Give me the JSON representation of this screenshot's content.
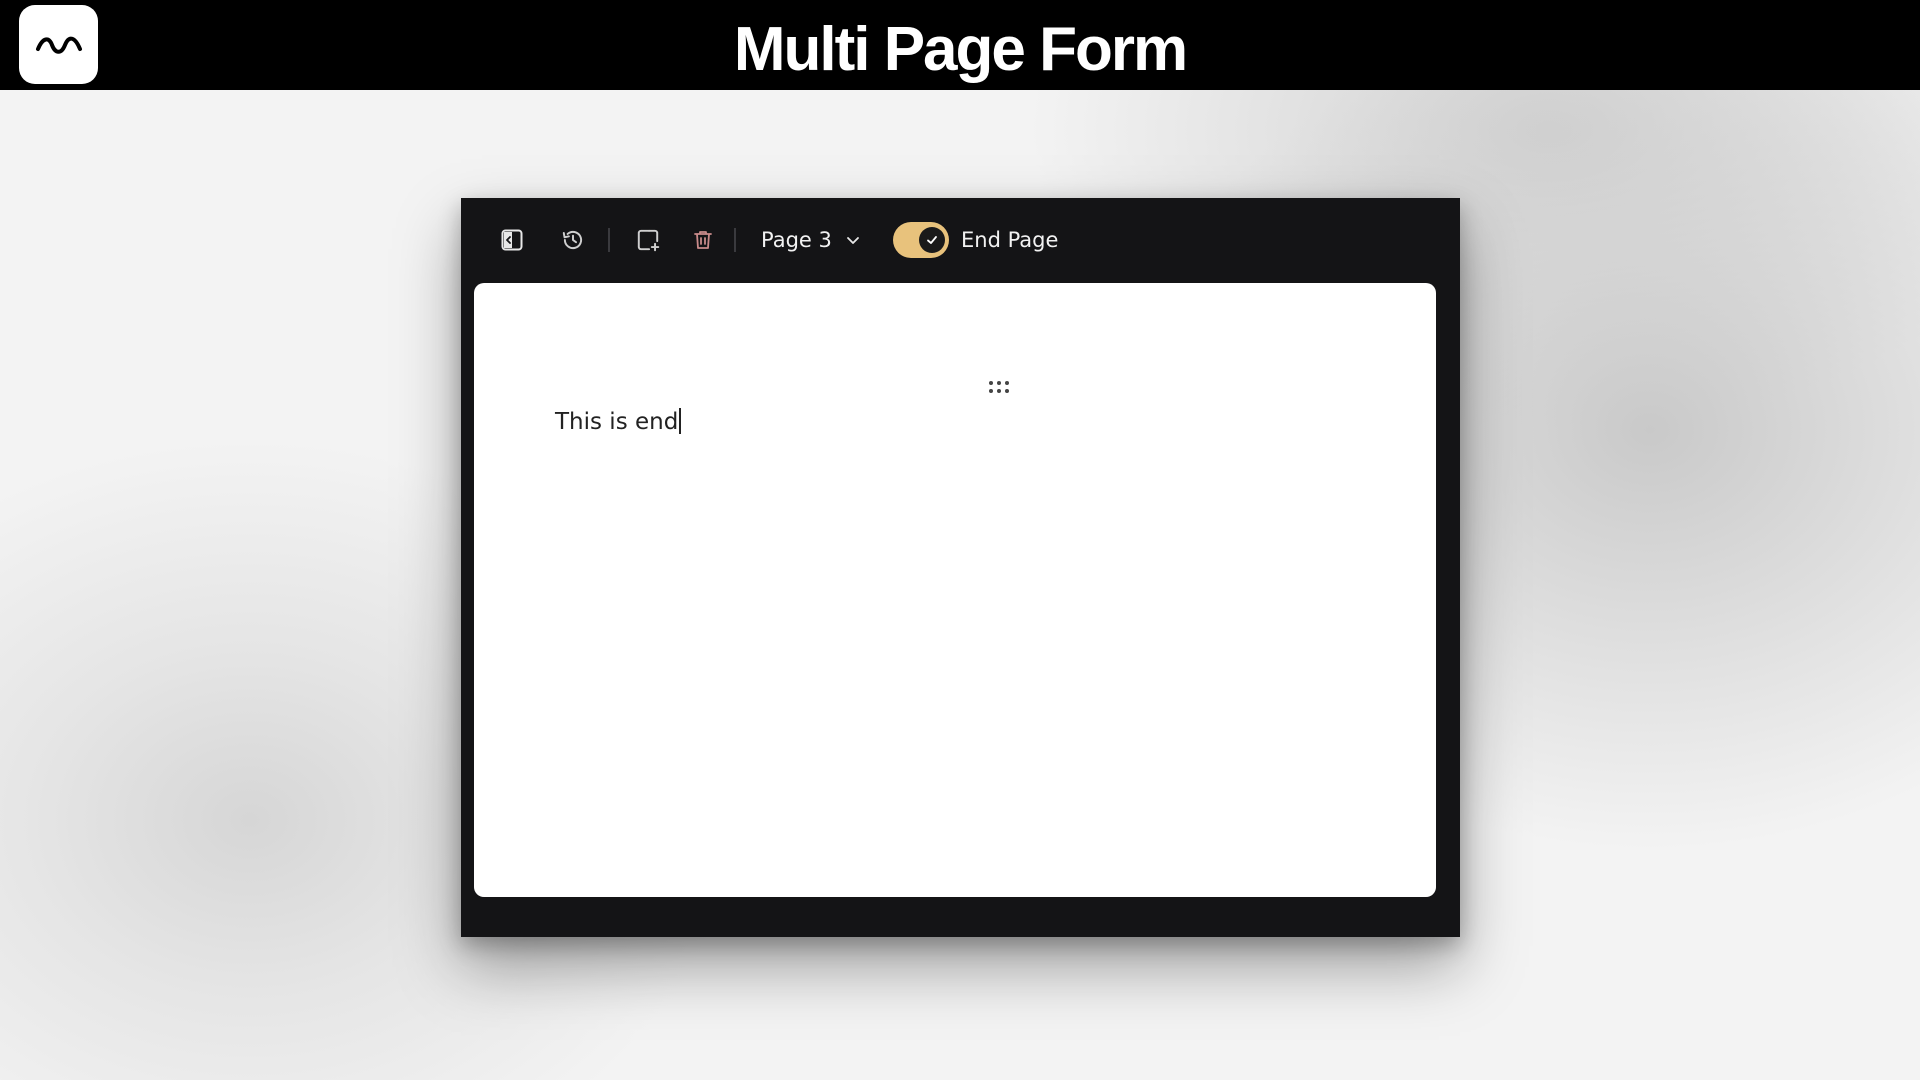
{
  "banner": {
    "title": "Multi Page Form",
    "logo_icon": "wave-logo-icon"
  },
  "toolbar": {
    "icons": [
      "sidebar-toggle-icon",
      "history-icon",
      "add-page-icon",
      "trash-icon"
    ],
    "page_selector": {
      "value": "Page 3",
      "icon": "chevron-down-icon"
    },
    "end_page_toggle": {
      "label": "End Page",
      "checked": true,
      "color": "#e8c27c"
    }
  },
  "canvas": {
    "text": "This is end"
  },
  "colors": {
    "banner_bg": "#000000",
    "window_bg": "#141416",
    "accent": "#e8c27c",
    "delete": "#c98a8a"
  }
}
